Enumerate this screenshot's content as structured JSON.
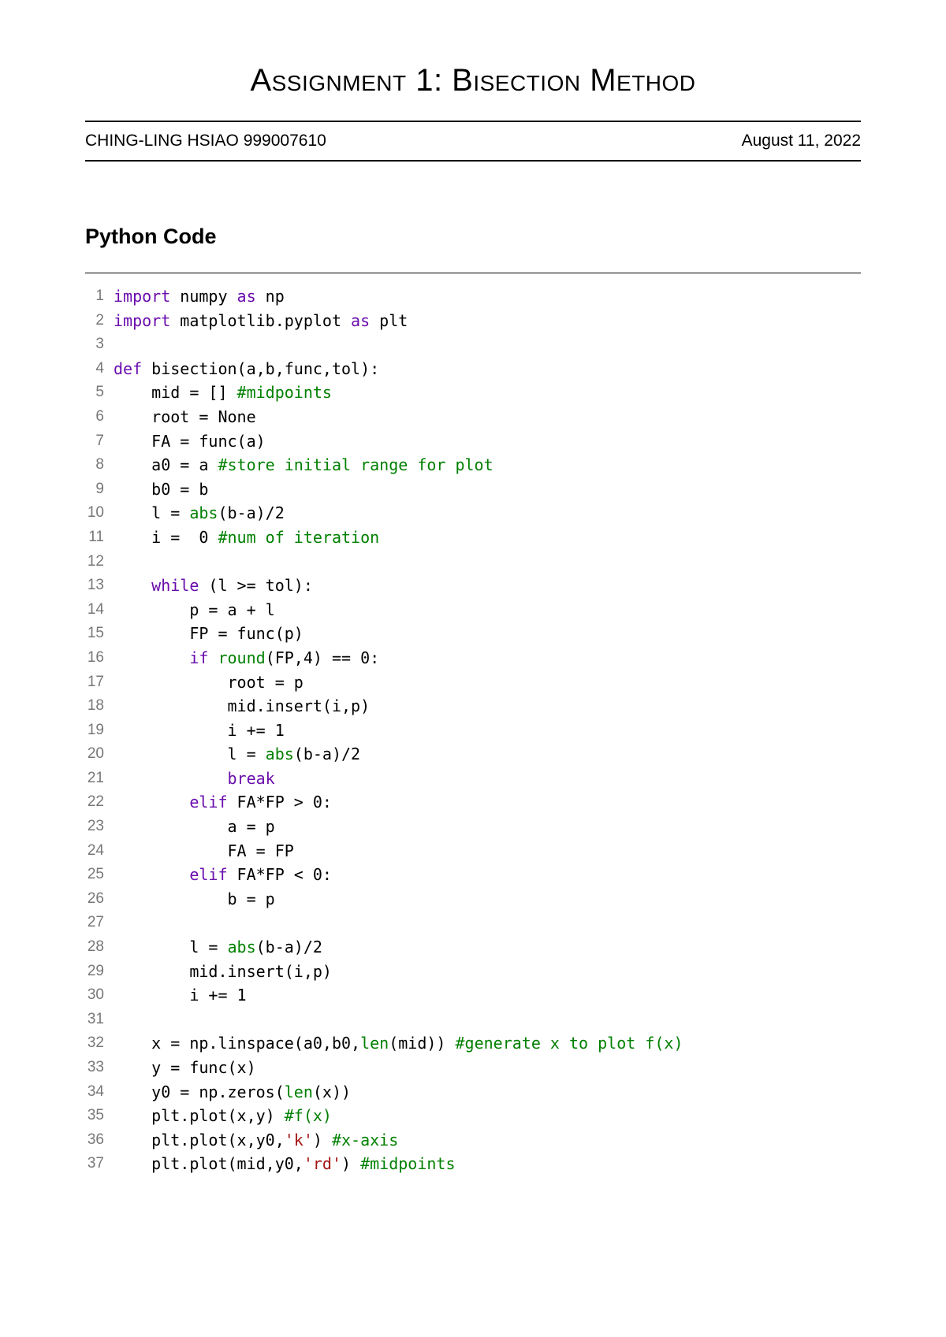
{
  "title": "Assignment 1: Bisection Method",
  "author": "CHING-LING HSIAO 999007610",
  "date": "August 11, 2022",
  "section": "Python Code",
  "code": [
    {
      "n": "1",
      "tokens": [
        {
          "t": "import",
          "c": "kw"
        },
        {
          "t": " numpy "
        },
        {
          "t": "as",
          "c": "kw"
        },
        {
          "t": " np"
        }
      ]
    },
    {
      "n": "2",
      "tokens": [
        {
          "t": "import",
          "c": "kw"
        },
        {
          "t": " matplotlib.pyplot "
        },
        {
          "t": "as",
          "c": "kw"
        },
        {
          "t": " plt"
        }
      ]
    },
    {
      "n": "3",
      "tokens": [
        {
          "t": ""
        }
      ]
    },
    {
      "n": "4",
      "tokens": [
        {
          "t": "def",
          "c": "kw"
        },
        {
          "t": " bisection(a,b,func,tol):"
        }
      ]
    },
    {
      "n": "5",
      "tokens": [
        {
          "t": "    mid = [] "
        },
        {
          "t": "#midpoints",
          "c": "comment"
        }
      ]
    },
    {
      "n": "6",
      "tokens": [
        {
          "t": "    root = None"
        }
      ]
    },
    {
      "n": "7",
      "tokens": [
        {
          "t": "    FA = func(a)"
        }
      ]
    },
    {
      "n": "8",
      "tokens": [
        {
          "t": "    a0 = a "
        },
        {
          "t": "#store initial range for plot",
          "c": "comment"
        }
      ]
    },
    {
      "n": "9",
      "tokens": [
        {
          "t": "    b0 = b"
        }
      ]
    },
    {
      "n": "10",
      "tokens": [
        {
          "t": "    l = "
        },
        {
          "t": "abs",
          "c": "builtin"
        },
        {
          "t": "(b-a)/2"
        }
      ]
    },
    {
      "n": "11",
      "tokens": [
        {
          "t": "    i =  0 "
        },
        {
          "t": "#num of iteration",
          "c": "comment"
        }
      ]
    },
    {
      "n": "12",
      "tokens": [
        {
          "t": ""
        }
      ]
    },
    {
      "n": "13",
      "tokens": [
        {
          "t": "    "
        },
        {
          "t": "while",
          "c": "kw"
        },
        {
          "t": " (l >= tol):"
        }
      ]
    },
    {
      "n": "14",
      "tokens": [
        {
          "t": "        p = a + l"
        }
      ]
    },
    {
      "n": "15",
      "tokens": [
        {
          "t": "        FP = func(p)"
        }
      ]
    },
    {
      "n": "16",
      "tokens": [
        {
          "t": "        "
        },
        {
          "t": "if",
          "c": "kw"
        },
        {
          "t": " "
        },
        {
          "t": "round",
          "c": "builtin"
        },
        {
          "t": "(FP,4) == 0:"
        }
      ]
    },
    {
      "n": "17",
      "tokens": [
        {
          "t": "            root = p"
        }
      ]
    },
    {
      "n": "18",
      "tokens": [
        {
          "t": "            mid.insert(i,p)"
        }
      ]
    },
    {
      "n": "19",
      "tokens": [
        {
          "t": "            i += 1"
        }
      ]
    },
    {
      "n": "20",
      "tokens": [
        {
          "t": "            l = "
        },
        {
          "t": "abs",
          "c": "builtin"
        },
        {
          "t": "(b-a)/2"
        }
      ]
    },
    {
      "n": "21",
      "tokens": [
        {
          "t": "            "
        },
        {
          "t": "break",
          "c": "kw"
        }
      ]
    },
    {
      "n": "22",
      "tokens": [
        {
          "t": "        "
        },
        {
          "t": "elif",
          "c": "kw"
        },
        {
          "t": " FA*FP > 0:"
        }
      ]
    },
    {
      "n": "23",
      "tokens": [
        {
          "t": "            a = p"
        }
      ]
    },
    {
      "n": "24",
      "tokens": [
        {
          "t": "            FA = FP"
        }
      ]
    },
    {
      "n": "25",
      "tokens": [
        {
          "t": "        "
        },
        {
          "t": "elif",
          "c": "kw"
        },
        {
          "t": " FA*FP < 0:"
        }
      ]
    },
    {
      "n": "26",
      "tokens": [
        {
          "t": "            b = p"
        }
      ]
    },
    {
      "n": "27",
      "tokens": [
        {
          "t": ""
        }
      ]
    },
    {
      "n": "28",
      "tokens": [
        {
          "t": "        l = "
        },
        {
          "t": "abs",
          "c": "builtin"
        },
        {
          "t": "(b-a)/2"
        }
      ]
    },
    {
      "n": "29",
      "tokens": [
        {
          "t": "        mid.insert(i,p)"
        }
      ]
    },
    {
      "n": "30",
      "tokens": [
        {
          "t": "        i += 1"
        }
      ]
    },
    {
      "n": "31",
      "tokens": [
        {
          "t": ""
        }
      ]
    },
    {
      "n": "32",
      "tokens": [
        {
          "t": "    x = np.linspace(a0,b0,"
        },
        {
          "t": "len",
          "c": "builtin"
        },
        {
          "t": "(mid)) "
        },
        {
          "t": "#generate x to plot f(x)",
          "c": "comment"
        }
      ]
    },
    {
      "n": "33",
      "tokens": [
        {
          "t": "    y = func(x)"
        }
      ]
    },
    {
      "n": "34",
      "tokens": [
        {
          "t": "    y0 = np.zeros("
        },
        {
          "t": "len",
          "c": "builtin"
        },
        {
          "t": "(x))"
        }
      ]
    },
    {
      "n": "35",
      "tokens": [
        {
          "t": "    plt.plot(x,y) "
        },
        {
          "t": "#f(x)",
          "c": "comment"
        }
      ]
    },
    {
      "n": "36",
      "tokens": [
        {
          "t": "    plt.plot(x,y0,"
        },
        {
          "t": "'k'",
          "c": "str"
        },
        {
          "t": ") "
        },
        {
          "t": "#x-axis",
          "c": "comment"
        }
      ]
    },
    {
      "n": "37",
      "tokens": [
        {
          "t": "    plt.plot(mid,y0,"
        },
        {
          "t": "'rd'",
          "c": "str"
        },
        {
          "t": ") "
        },
        {
          "t": "#midpoints",
          "c": "comment"
        }
      ]
    }
  ]
}
